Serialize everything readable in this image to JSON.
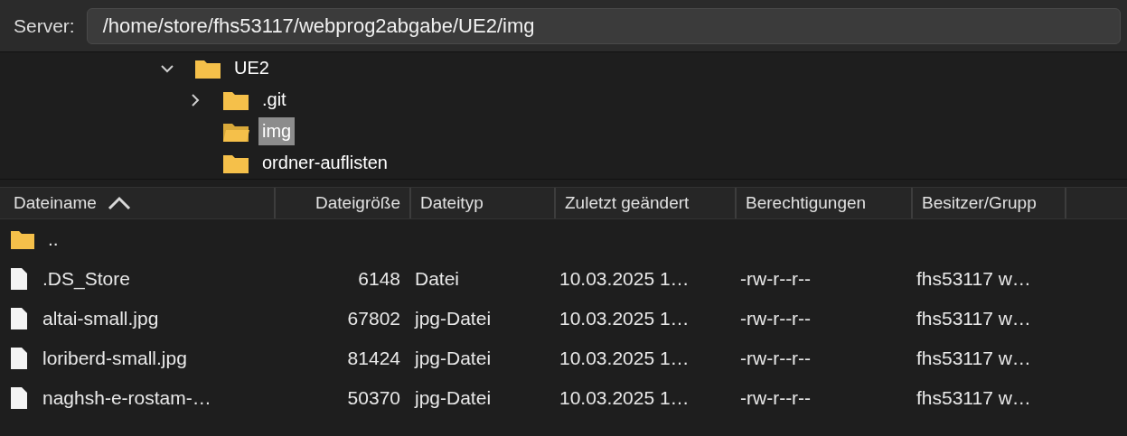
{
  "server": {
    "label": "Server:",
    "path": "/home/store/fhs53117/webprog2abgabe/UE2/img"
  },
  "tree": [
    {
      "label": "UE2",
      "expanded": true,
      "selected": false,
      "children": [
        {
          "label": ".git",
          "expanded": false,
          "selected": false
        },
        {
          "label": "img",
          "selected": true
        },
        {
          "label": "ordner-auflisten",
          "selected": false
        }
      ]
    }
  ],
  "table": {
    "columns": [
      {
        "label": "Dateiname",
        "sorted": true
      },
      {
        "label": "Dateigröße",
        "sorted": false
      },
      {
        "label": "Dateityp",
        "sorted": false
      },
      {
        "label": "Zuletzt geändert",
        "sorted": false
      },
      {
        "label": "Berechtigungen",
        "sorted": false
      },
      {
        "label": "Besitzer/Grupp",
        "sorted": false
      }
    ],
    "rows": [
      {
        "kind": "folder",
        "cells": [
          "..",
          "",
          "",
          "",
          "",
          ""
        ]
      },
      {
        "kind": "file",
        "cells": [
          ".DS_Store",
          "6148",
          "Datei",
          "10.03.2025 1…",
          "-rw-r--r--",
          "fhs53117 w…"
        ]
      },
      {
        "kind": "file",
        "cells": [
          "altai-small.jpg",
          "67802",
          "jpg-Datei",
          "10.03.2025 1…",
          "-rw-r--r--",
          "fhs53117 w…"
        ]
      },
      {
        "kind": "file",
        "cells": [
          "loriberd-small.jpg",
          "81424",
          "jpg-Datei",
          "10.03.2025 1…",
          "-rw-r--r--",
          "fhs53117 w…"
        ]
      },
      {
        "kind": "file",
        "cells": [
          "naghsh-e-rostam-…",
          "50370",
          "jpg-Datei",
          "10.03.2025 1…",
          "-rw-r--r--",
          "fhs53117 w…"
        ]
      }
    ]
  }
}
